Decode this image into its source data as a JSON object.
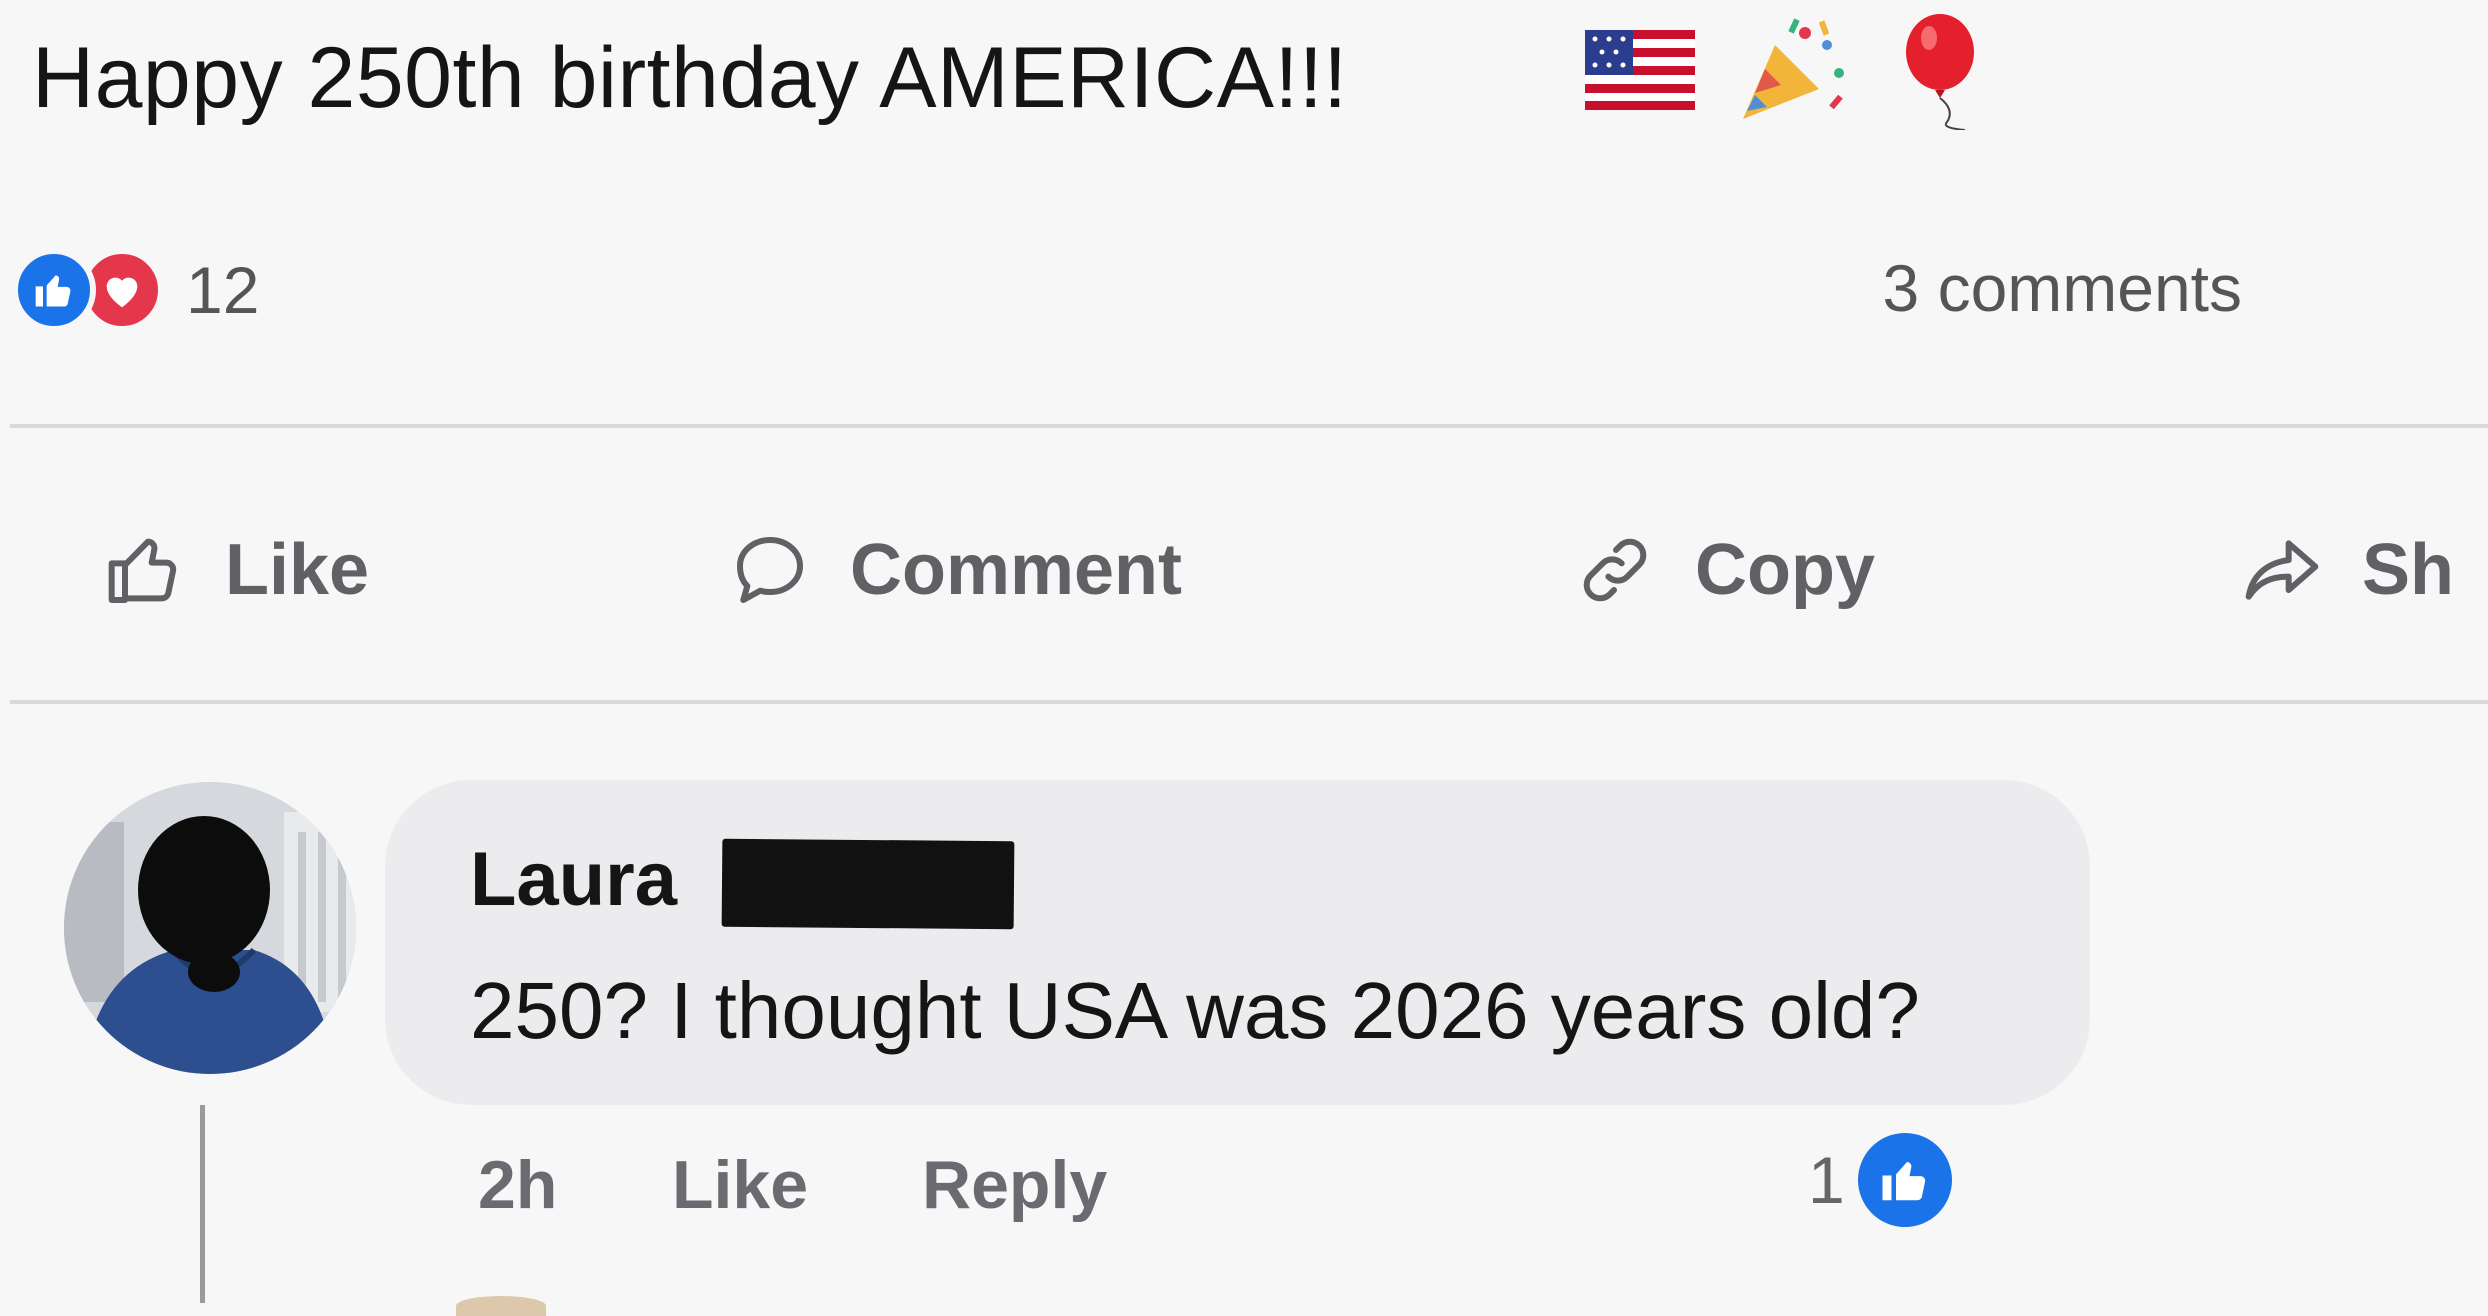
{
  "post": {
    "text": "Happy 250th birthday AMERICA!!!",
    "emojis": [
      "us-flag-icon",
      "party-popper-icon",
      "balloon-icon"
    ]
  },
  "reactions": {
    "types": [
      "like",
      "love"
    ],
    "count": "12",
    "comments_count": "3 comments"
  },
  "actions": {
    "like_label": "Like",
    "comment_label": "Comment",
    "copy_label": "Copy",
    "share_label": "Sh"
  },
  "comment": {
    "author_first": "Laura",
    "author_last_redacted": true,
    "text": "250? I thought USA was 2026 years old?",
    "time": "2h",
    "like_label": "Like",
    "reply_label": "Reply",
    "like_count": "1"
  },
  "colors": {
    "background": "#f7f7f8",
    "like_blue": "#1a73e8",
    "love_red": "#e5374b",
    "bubble": "#ececef",
    "muted_text": "#5f6165"
  }
}
